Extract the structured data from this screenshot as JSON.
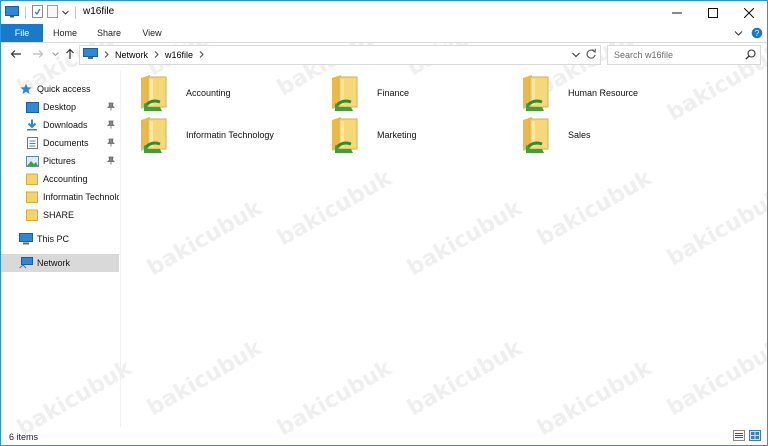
{
  "window": {
    "title": "w16file"
  },
  "ribbon": {
    "tabs": [
      "File",
      "Home",
      "Share",
      "View"
    ]
  },
  "address": {
    "crumbs": [
      "Network",
      "w16file"
    ],
    "search_placeholder": "Search w16file"
  },
  "sidebar": {
    "items": [
      {
        "label": "Quick access",
        "icon": "star-icon"
      },
      {
        "label": "Desktop",
        "icon": "desktop-icon",
        "pinned": true
      },
      {
        "label": "Downloads",
        "icon": "downloads-icon",
        "pinned": true
      },
      {
        "label": "Documents",
        "icon": "documents-icon",
        "pinned": true
      },
      {
        "label": "Pictures",
        "icon": "pictures-icon",
        "pinned": true
      },
      {
        "label": "Accounting",
        "icon": "folder-icon"
      },
      {
        "label": "Informatin Technolo",
        "icon": "folder-icon"
      },
      {
        "label": "SHARE",
        "icon": "folder-icon"
      },
      {
        "label": "This PC",
        "icon": "computer-icon"
      },
      {
        "label": "Network",
        "icon": "network-icon",
        "selected": true
      }
    ]
  },
  "folders": [
    {
      "label": "Accounting"
    },
    {
      "label": "Finance"
    },
    {
      "label": "Human Resource"
    },
    {
      "label": "Informatin Technology"
    },
    {
      "label": "Marketing"
    },
    {
      "label": "Sales"
    }
  ],
  "status": {
    "count": "6 items"
  },
  "watermark": "bakicubuk",
  "colors": {
    "accent": "#1979ca",
    "folder": "#f5d36b",
    "share_arrow": "#3aa23a",
    "selection": "#d9d9d9"
  }
}
